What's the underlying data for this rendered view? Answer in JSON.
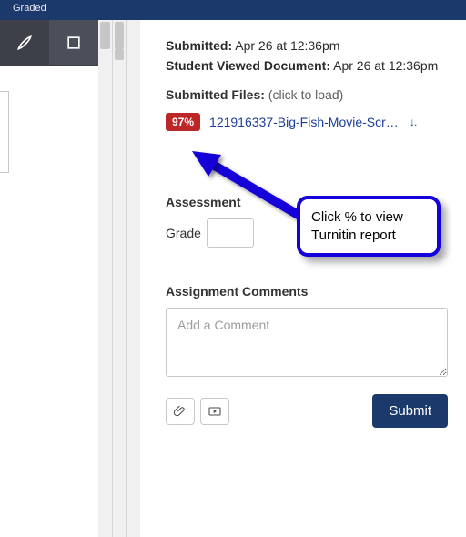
{
  "topbar": {
    "crumb": "Graded"
  },
  "meta": {
    "submitted_label": "Submitted:",
    "submitted_value": "Apr 26 at 12:36pm",
    "viewed_label": "Student Viewed Document:",
    "viewed_value": "Apr 26 at 12:36pm"
  },
  "files": {
    "label": "Submitted Files:",
    "hint": "(click to load)",
    "items": [
      {
        "percent": "97%",
        "name": "121916337-Big-Fish-Movie-Script.…"
      }
    ]
  },
  "assessment": {
    "heading": "Assessment",
    "grade_label": "Grade",
    "grade_value": ""
  },
  "comments": {
    "heading": "Assignment Comments",
    "placeholder": "Add a Comment",
    "submit": "Submit"
  },
  "callout": {
    "text": "Click % to view Turnitin report"
  },
  "colors": {
    "navy": "#1b3a6b",
    "badge_red": "#bd2626",
    "annotation_blue": "#1400d8"
  }
}
